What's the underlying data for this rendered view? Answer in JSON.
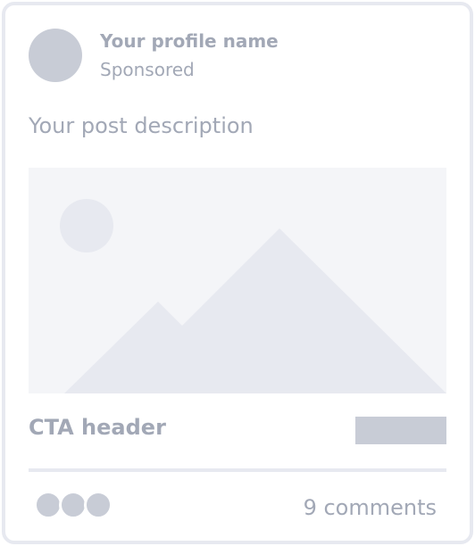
{
  "post": {
    "profile_name": "Your profile name",
    "sponsored_label": "Sponsored",
    "description": "Your post description",
    "media": {
      "icon": "image-placeholder-icon"
    },
    "cta_header": "CTA header",
    "reactions_count_shown": 3,
    "comments_label": "9 comments"
  },
  "colors": {
    "placeholder_dark": "#c8ccd6",
    "placeholder_light": "#e7e9f0",
    "media_background": "#f4f5f8",
    "text_muted": "#a2a8b6"
  }
}
